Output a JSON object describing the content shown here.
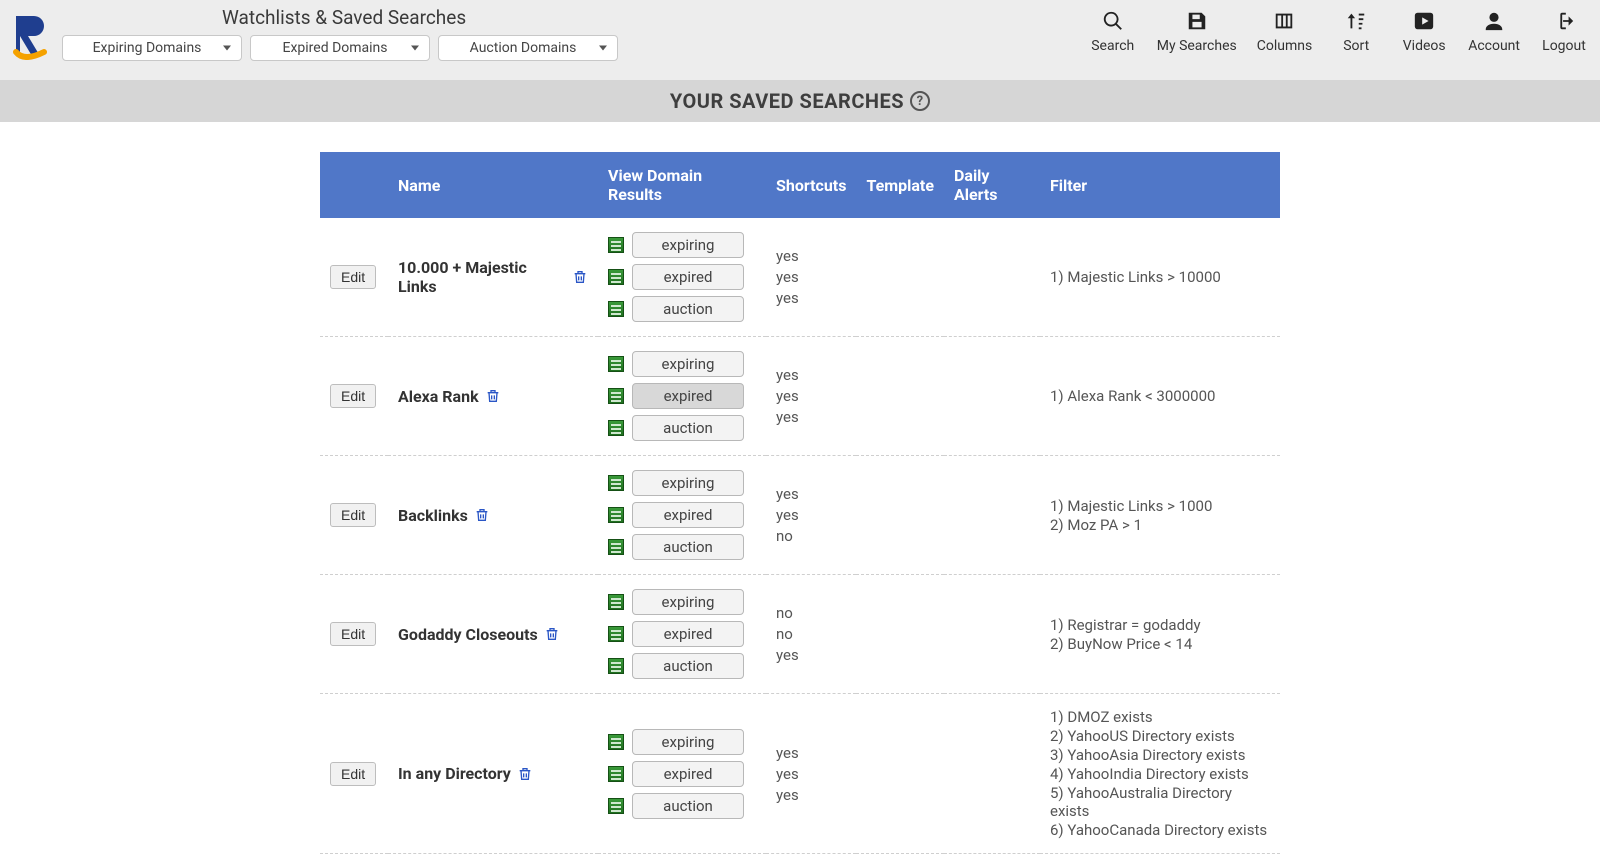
{
  "header": {
    "title": "Watchlists & Saved Searches",
    "dropdowns": [
      "Expiring Domains",
      "Expired Domains",
      "Auction Domains"
    ]
  },
  "nav": [
    {
      "label": "Search"
    },
    {
      "label": "My Searches"
    },
    {
      "label": "Columns"
    },
    {
      "label": "Sort"
    },
    {
      "label": "Videos"
    },
    {
      "label": "Account"
    },
    {
      "label": "Logout"
    }
  ],
  "subheader": "YOUR SAVED SEARCHES",
  "columns": {
    "name": "Name",
    "view": "View Domain Results",
    "shortcuts": "Shortcuts",
    "template": "Template",
    "alerts": "Daily Alerts",
    "filter": "Filter"
  },
  "editLabel": "Edit",
  "viewLabels": {
    "expiring": "expiring",
    "expired": "expired",
    "auction": "auction"
  },
  "rows": [
    {
      "name": "10.000 + Majestic Links",
      "views": [
        "expiring",
        "expired",
        "auction"
      ],
      "activeView": "",
      "shortcuts": [
        "yes",
        "yes",
        "yes"
      ],
      "filters": [
        "1) Majestic Links > 10000"
      ]
    },
    {
      "name": "Alexa Rank",
      "views": [
        "expiring",
        "expired",
        "auction"
      ],
      "activeView": "expired",
      "shortcuts": [
        "yes",
        "yes",
        "yes"
      ],
      "filters": [
        "1) Alexa Rank < 3000000"
      ]
    },
    {
      "name": "Backlinks",
      "views": [
        "expiring",
        "expired",
        "auction"
      ],
      "activeView": "",
      "shortcuts": [
        "yes",
        "yes",
        "no"
      ],
      "filters": [
        "1) Majestic Links > 1000",
        "2) Moz PA > 1"
      ]
    },
    {
      "name": "Godaddy Closeouts",
      "views": [
        "expiring",
        "expired",
        "auction"
      ],
      "activeView": "",
      "shortcuts": [
        "no",
        "no",
        "yes"
      ],
      "filters": [
        "1) Registrar = godaddy",
        "2) BuyNow Price < 14"
      ]
    },
    {
      "name": "In any Directory",
      "views": [
        "expiring",
        "expired",
        "auction"
      ],
      "activeView": "",
      "shortcuts": [
        "yes",
        "yes",
        "yes"
      ],
      "filters": [
        "1) DMOZ exists",
        "2) YahooUS Directory exists",
        "3) YahooAsia Directory exists",
        "4) YahooIndia Directory exists",
        "5) YahooAustralia Directory exists",
        "6) YahooCanada Directory exists"
      ]
    }
  ]
}
